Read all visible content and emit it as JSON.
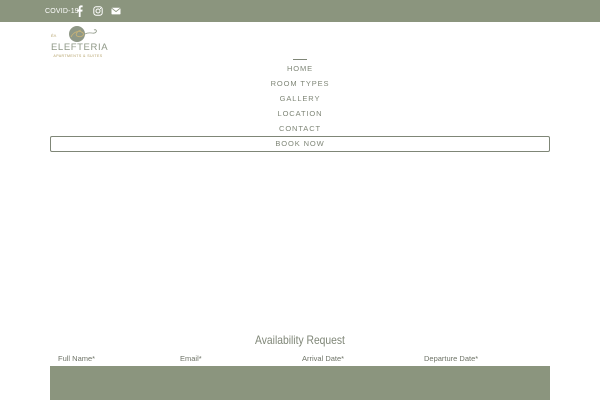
{
  "topbar": {
    "covid_label": "COVID-19",
    "icons": [
      "facebook-icon",
      "instagram-icon",
      "envelope-icon"
    ],
    "background": "#8b957e"
  },
  "logo": {
    "name": "ELEFTERIA",
    "subtitle": "APARTMENTS & SUITES",
    "accent": "#b5a26a"
  },
  "nav": {
    "items": [
      "HOME",
      "ROOM TYPES",
      "GALLERY",
      "LOCATION",
      "CONTACT"
    ],
    "active": "HOME",
    "book_label": "BOOK NOW"
  },
  "availability": {
    "title": "Availability Request",
    "fields": [
      "Full Name*",
      "Email*",
      "Arrival Date*",
      "Departure Date*"
    ]
  },
  "colors": {
    "brand": "#8b957e",
    "text": "#7f8677"
  }
}
